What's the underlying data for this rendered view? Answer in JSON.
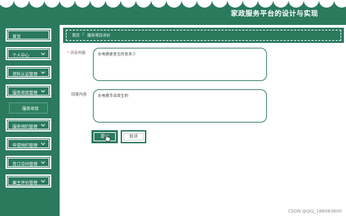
{
  "header": {
    "title": "家政服务平台的设计与实现"
  },
  "sidebar": {
    "items": [
      {
        "label": "首页"
      },
      {
        "label": "个人中心"
      },
      {
        "label": "资料认证管理"
      },
      {
        "label": "服务项目管理"
      },
      {
        "label": "服务预约管理"
      },
      {
        "label": "申请预约管理"
      },
      {
        "label": "签订合同管理"
      },
      {
        "label": "雇主评价管理"
      }
    ],
    "active_sub": {
      "label": "服务项目"
    }
  },
  "breadcrumb": {
    "home": "首页",
    "separator": "/",
    "current": "服务项目评价"
  },
  "form": {
    "comment_label": "评论内容",
    "comment_required_mark": "*",
    "comment_value": "水电费是发生的发多少",
    "reply_label": "回复内容",
    "reply_value": "水电费手动发生的"
  },
  "buttons": {
    "submit": "提交",
    "cancel": "取消"
  },
  "watermark": "CSDN @QQ_188083800",
  "colors": {
    "primary": "#2b7a5e",
    "required": "#e74c3c"
  }
}
